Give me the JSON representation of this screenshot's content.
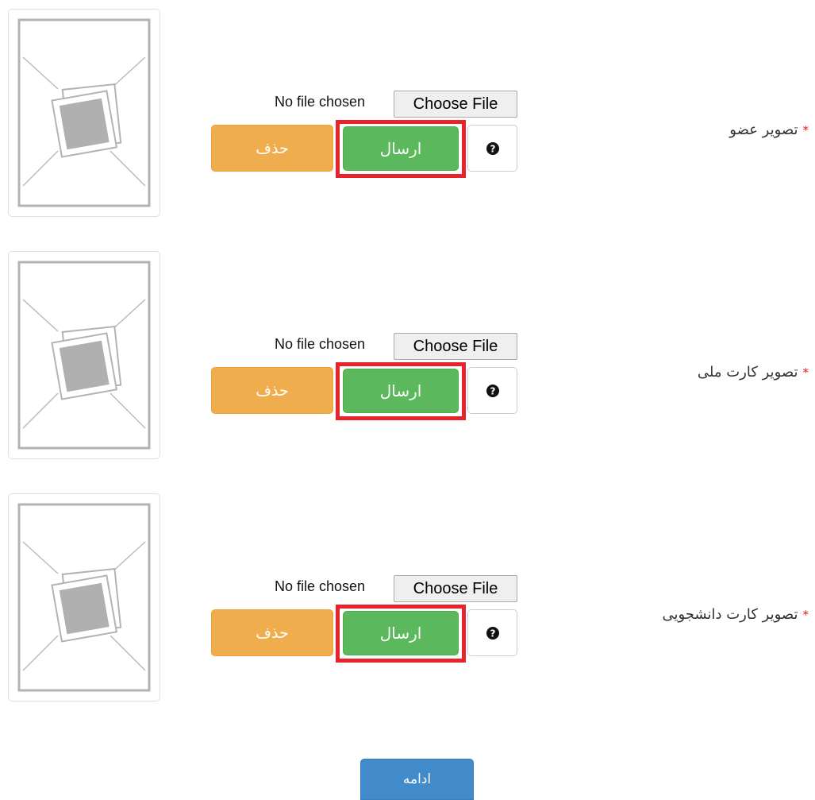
{
  "upload_rows": [
    {
      "label": "تصویر عضو",
      "required_mark": "*",
      "file_status": "No file chosen",
      "choose_file_label": "Choose File",
      "send_label": "ارسال",
      "delete_label": "حذف",
      "help_icon": "question-circle-icon"
    },
    {
      "label": "تصویر کارت ملی",
      "required_mark": "*",
      "file_status": "No file chosen",
      "choose_file_label": "Choose File",
      "send_label": "ارسال",
      "delete_label": "حذف",
      "help_icon": "question-circle-icon"
    },
    {
      "label": "تصویر کارت دانشجویی",
      "required_mark": "*",
      "file_status": "No file chosen",
      "choose_file_label": "Choose File",
      "send_label": "ارسال",
      "delete_label": "حذف",
      "help_icon": "question-circle-icon"
    }
  ],
  "continue_label": "ادامه",
  "colors": {
    "send": "#5cb85c",
    "delete": "#f0ad4e",
    "continue": "#428bca",
    "highlight": "#e8232b",
    "required": "#e01b24"
  }
}
